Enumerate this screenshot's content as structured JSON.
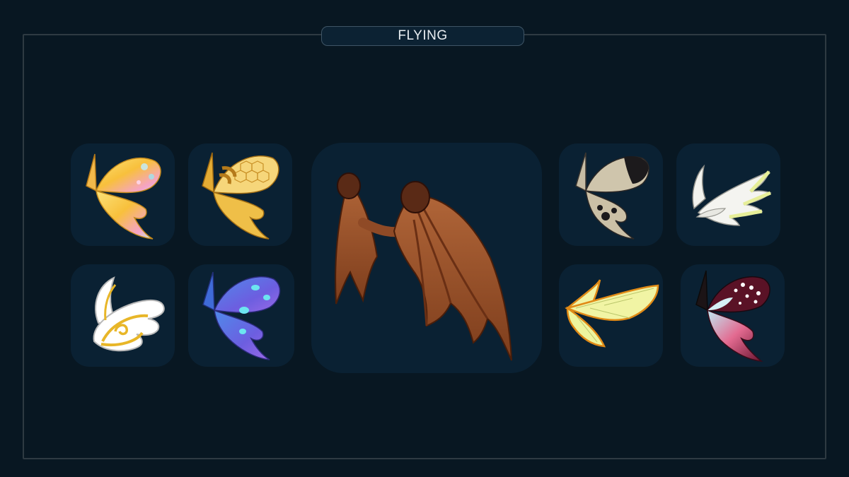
{
  "header": {
    "title": "FLYING"
  },
  "items": [
    {
      "id": "rainbow-butterfly-wings",
      "icon": "rainbow-butterfly-wings-icon",
      "colors": [
        "#f7d34a",
        "#f59fc5",
        "#9fe3f0"
      ]
    },
    {
      "id": "honeycomb-wings",
      "icon": "honeycomb-wings-icon",
      "colors": [
        "#e8b43a",
        "#fbe49a"
      ]
    },
    {
      "id": "bat-wings",
      "icon": "bat-wings-icon",
      "colors": [
        "#a1582f",
        "#6d3418"
      ]
    },
    {
      "id": "moth-wings",
      "icon": "moth-wings-icon",
      "colors": [
        "#c9bfa7",
        "#1c1a1c"
      ]
    },
    {
      "id": "white-feather-wings",
      "icon": "white-feather-wings-icon",
      "colors": [
        "#f3f3ef",
        "#e4ee96"
      ]
    },
    {
      "id": "golden-angel-wings",
      "icon": "golden-angel-wings-icon",
      "colors": [
        "#ffffff",
        "#e8b628"
      ]
    },
    {
      "id": "blue-butterfly-wings",
      "icon": "blue-butterfly-wings-icon",
      "colors": [
        "#4d7fe6",
        "#8a5fe0",
        "#6ce5f0"
      ]
    },
    {
      "id": "cicada-wings",
      "icon": "cicada-wings-icon",
      "colors": [
        "#f1f4a4",
        "#f29a20"
      ]
    },
    {
      "id": "crimson-butterfly-wings",
      "icon": "crimson-butterfly-wings-icon",
      "colors": [
        "#5a1226",
        "#e34d72",
        "#ffffff"
      ]
    }
  ]
}
